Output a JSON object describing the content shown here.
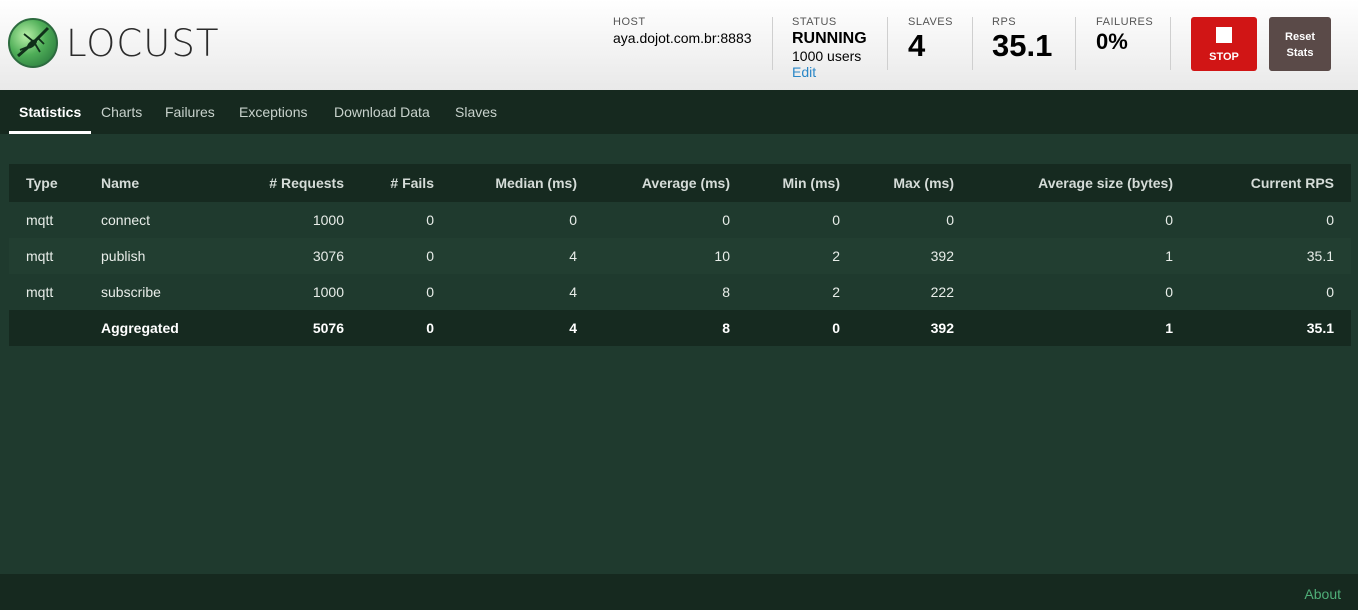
{
  "header": {
    "logo_text": "LOCUST",
    "host": {
      "label": "HOST",
      "value": "aya.dojot.com.br:8883"
    },
    "status": {
      "label": "STATUS",
      "value": "RUNNING",
      "users": "1000 users",
      "edit": "Edit"
    },
    "slaves": {
      "label": "SLAVES",
      "value": "4"
    },
    "rps": {
      "label": "RPS",
      "value": "35.1"
    },
    "failures": {
      "label": "FAILURES",
      "value": "0%"
    },
    "stop_label": "STOP",
    "reset_label_1": "Reset",
    "reset_label_2": "Stats"
  },
  "tabs": [
    {
      "label": "Statistics"
    },
    {
      "label": "Charts"
    },
    {
      "label": "Failures"
    },
    {
      "label": "Exceptions"
    },
    {
      "label": "Download Data"
    },
    {
      "label": "Slaves"
    }
  ],
  "table": {
    "columns": [
      "Type",
      "Name",
      "# Requests",
      "# Fails",
      "Median (ms)",
      "Average (ms)",
      "Min (ms)",
      "Max (ms)",
      "Average size (bytes)",
      "Current RPS"
    ],
    "rows": [
      [
        "mqtt",
        "connect",
        "1000",
        "0",
        "0",
        "0",
        "0",
        "0",
        "0",
        "0"
      ],
      [
        "mqtt",
        "publish",
        "3076",
        "0",
        "4",
        "10",
        "2",
        "392",
        "1",
        "35.1"
      ],
      [
        "mqtt",
        "subscribe",
        "1000",
        "0",
        "4",
        "8",
        "2",
        "222",
        "0",
        "0"
      ]
    ],
    "total": [
      "",
      "Aggregated",
      "5076",
      "0",
      "4",
      "8",
      "0",
      "392",
      "1",
      "35.1"
    ]
  },
  "footer": {
    "about": "About"
  },
  "colors": {
    "background": "#1f3a2e",
    "tabbar": "#16291f",
    "stop_button": "#d11515",
    "reset_button": "#5a4a48",
    "link": "#2a87c7",
    "about_link": "#4fae78"
  }
}
